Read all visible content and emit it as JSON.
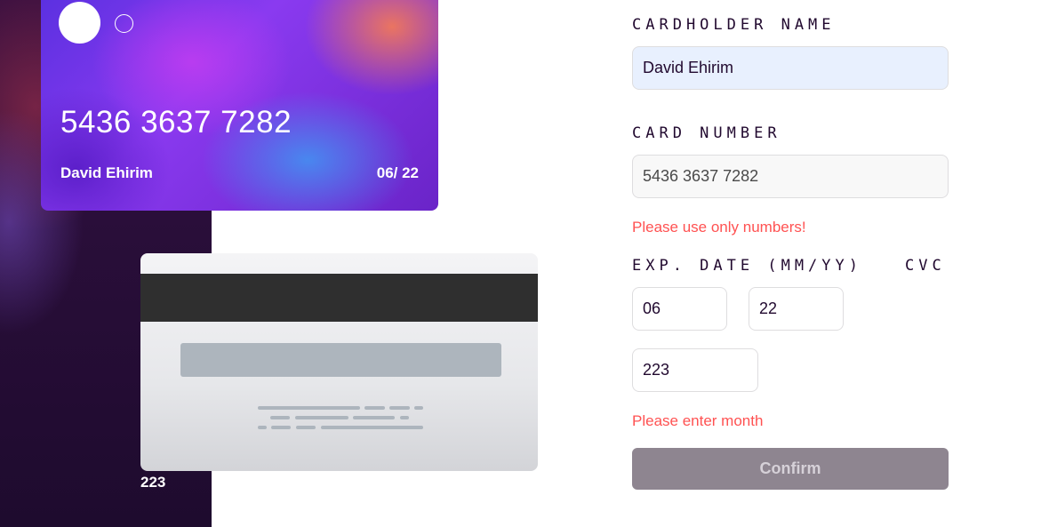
{
  "card_front": {
    "number": "5436 3637 7282",
    "name": "David Ehirim",
    "expiry": "06/ 22"
  },
  "card_back": {
    "cvc": "223"
  },
  "form": {
    "cardholder_label": "CARDHOLDER NAME",
    "cardholder_value": "David Ehirim",
    "card_number_label": "CARD NUMBER",
    "card_number_value": "5436 3637 7282",
    "card_number_error": "Please use only numbers!",
    "exp_label": "EXP. DATE (MM/YY)",
    "cvc_label": "CVC",
    "month_value": "06",
    "year_value": "22",
    "cvc_value": "223",
    "date_error": "Please enter month",
    "confirm_label": "Confirm"
  },
  "colors": {
    "error": "#ff5252",
    "button": "#8e8590",
    "label": "#21092f"
  }
}
